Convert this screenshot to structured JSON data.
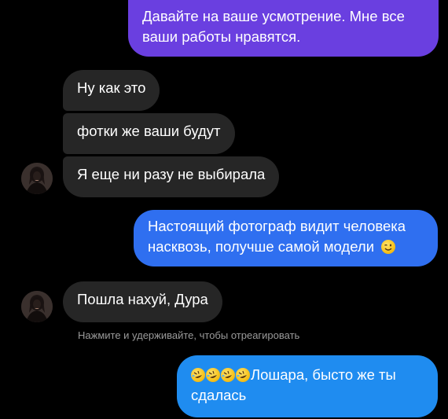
{
  "chat": {
    "messages": [
      {
        "text_lines": [
          "Давайте на ваше усмотрение. Мне все",
          "ваши работы нравятся."
        ]
      },
      {
        "text": "Ну как это"
      },
      {
        "text": "фотки же ваши будут"
      },
      {
        "text": "Я еще ни разу не выбирала"
      },
      {
        "text_lines": [
          "Настоящий фотограф видит человека",
          "насквозь, получше самой модели"
        ],
        "emoji": "winking-face-emoji"
      },
      {
        "text": "Пошла нахуй, Дура"
      },
      {
        "text_lines": [
          "Лошара, бысто же ты",
          "сдалась"
        ],
        "emoji": "rolling-on-floor-laughing-emoji"
      }
    ],
    "hint": "Нажмите и удерживайте, чтобы отреагировать"
  },
  "colors": {
    "background": "#000000",
    "incoming_bubble": "#262626",
    "outgoing_purple": "#6a3fe0",
    "outgoing_blue": "#2f6ff0",
    "outgoing_light_blue": "#1f8cf0",
    "hint_text": "#9a9a9a"
  }
}
